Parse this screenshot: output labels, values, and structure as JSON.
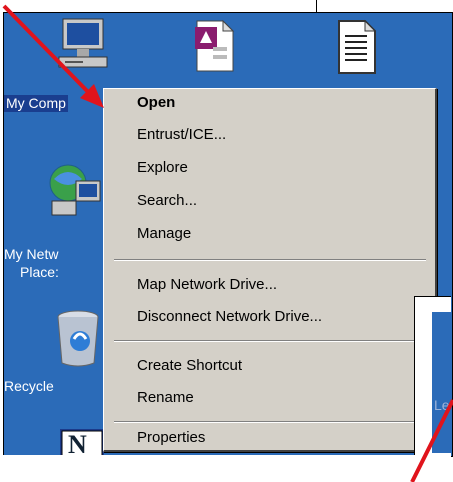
{
  "desktop": {
    "icons": [
      {
        "id": "my-computer",
        "label": "My Comp"
      },
      {
        "id": "my-network",
        "label_line1": "My Netw",
        "label_line2": "Place:"
      },
      {
        "id": "recycle-bin",
        "label": "Recycle"
      }
    ],
    "background_color": "#2b6bb8"
  },
  "context_menu": {
    "groups": [
      [
        "Open",
        "Entrust/ICE...",
        "Explore",
        "Search...",
        "Manage"
      ],
      [
        "Map Network Drive...",
        "Disconnect Network Drive..."
      ],
      [
        "Create Shortcut",
        "Rename"
      ],
      [
        "Properties"
      ]
    ],
    "default_item": "Open"
  },
  "inset": {
    "partial_text": "Le"
  },
  "annotations": {
    "arrow_color": "#e0141c"
  }
}
